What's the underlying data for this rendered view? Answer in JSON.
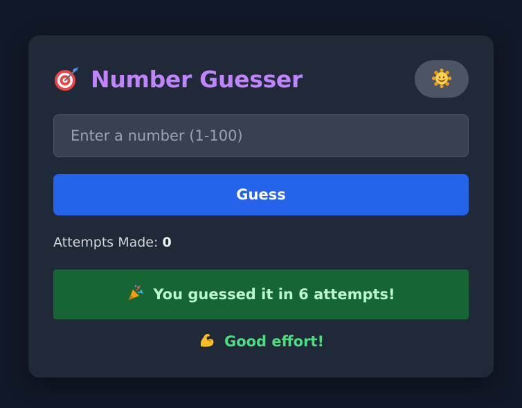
{
  "app": {
    "title": "Number Guesser",
    "title_icon": "target-dart-icon"
  },
  "theme_toggle": {
    "icon": "sun-face-icon"
  },
  "input": {
    "placeholder": "Enter a number (1-100)",
    "value": ""
  },
  "guess_button": {
    "label": "Guess"
  },
  "attempts": {
    "label": "Attempts Made:",
    "count": "0"
  },
  "result": {
    "icon": "party-popper-icon",
    "text": "You guessed it in 6 attempts!"
  },
  "feedback": {
    "icon": "flexed-biceps-icon",
    "text": "Good effort!"
  },
  "colors": {
    "background": "#111827",
    "card": "#1f2937",
    "title": "#c084fc",
    "button": "#2563eb",
    "result_bg": "#166534",
    "result_text": "#bbf7d0",
    "feedback_text": "#4ade80"
  }
}
